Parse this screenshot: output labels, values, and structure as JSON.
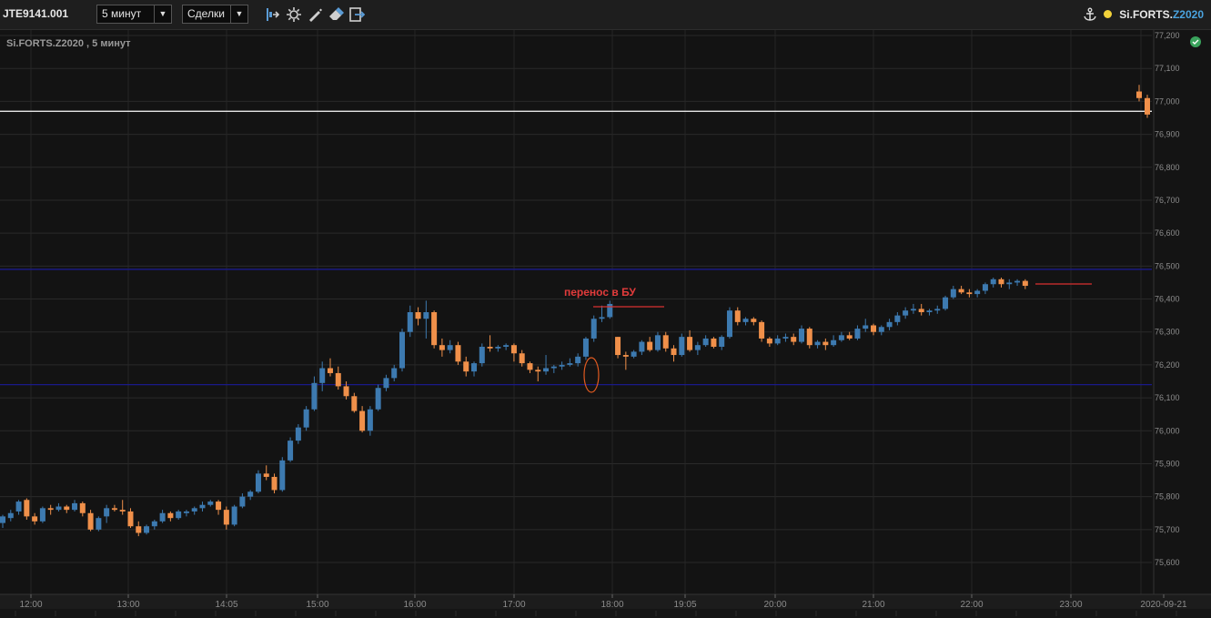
{
  "toolbar": {
    "account": "JTE9141.001",
    "timeframe": "5 минут",
    "mode": "Сделки",
    "symbol_prefix": "Si.FORTS.",
    "symbol_contract": "Z2020"
  },
  "chart_data": {
    "type": "candlestick",
    "title": "Si.FORTS.Z2020 , 5 минут",
    "y_ticks": [
      "77,200",
      "77,100",
      "77,000",
      "76,900",
      "76,800",
      "76,700",
      "76,600",
      "76,500",
      "76,400",
      "76,300",
      "76,200",
      "76,100",
      "76,000",
      "75,900",
      "75,800",
      "75,700",
      "75,600"
    ],
    "x_ticks": [
      "12:00",
      "13:00",
      "14:05",
      "15:00",
      "16:00",
      "17:00",
      "18:00",
      "19:05",
      "20:00",
      "21:00",
      "22:00",
      "23:00",
      "2020-09-21"
    ],
    "ylim": [
      75550,
      77220
    ],
    "annotation": "перенос в БУ",
    "horizontal_lines": [
      {
        "price": 76970,
        "color": "#ffffff"
      },
      {
        "price": 76490,
        "color": "#1a1a8a"
      },
      {
        "price": 76140,
        "color": "#1a1a8a"
      }
    ],
    "up_color": "#3d7ab0",
    "down_color": "#f0904a",
    "candles": [
      [
        75720,
        75745,
        75705,
        75740
      ],
      [
        75735,
        75760,
        75725,
        75750
      ],
      [
        75755,
        75790,
        75745,
        75785
      ],
      [
        75790,
        75795,
        75730,
        75740
      ],
      [
        75740,
        75750,
        75715,
        75725
      ],
      [
        75725,
        75770,
        75720,
        75765
      ],
      [
        75765,
        75775,
        75745,
        75760
      ],
      [
        75760,
        75780,
        75755,
        75770
      ],
      [
        75770,
        75775,
        75750,
        75760
      ],
      [
        75760,
        75790,
        75755,
        75780
      ],
      [
        75780,
        75785,
        75740,
        75750
      ],
      [
        75750,
        75760,
        75695,
        75700
      ],
      [
        75700,
        75740,
        75695,
        75735
      ],
      [
        75740,
        75775,
        75720,
        75765
      ],
      [
        75765,
        75775,
        75755,
        75760
      ],
      [
        75760,
        75790,
        75745,
        75755
      ],
      [
        75755,
        75765,
        75705,
        75710
      ],
      [
        75710,
        75725,
        75680,
        75690
      ],
      [
        75690,
        75715,
        75685,
        75710
      ],
      [
        75710,
        75730,
        75700,
        75725
      ],
      [
        75725,
        75760,
        75720,
        75750
      ],
      [
        75750,
        75755,
        75725,
        75735
      ],
      [
        75735,
        75760,
        75730,
        75755
      ],
      [
        75750,
        75760,
        75740,
        75755
      ],
      [
        75755,
        75770,
        75745,
        75765
      ],
      [
        75765,
        75785,
        75755,
        75775
      ],
      [
        75775,
        75790,
        75770,
        75785
      ],
      [
        75785,
        75790,
        75745,
        75760
      ],
      [
        75760,
        75770,
        75700,
        75715
      ],
      [
        75715,
        75775,
        75710,
        75770
      ],
      [
        75770,
        75810,
        75765,
        75800
      ],
      [
        75800,
        75820,
        75790,
        75815
      ],
      [
        75815,
        75880,
        75810,
        75870
      ],
      [
        75870,
        75895,
        75850,
        75860
      ],
      [
        75860,
        75870,
        75810,
        75820
      ],
      [
        75820,
        75920,
        75815,
        75910
      ],
      [
        75910,
        75980,
        75905,
        75970
      ],
      [
        75970,
        76020,
        75960,
        76010
      ],
      [
        76010,
        76075,
        76000,
        76065
      ],
      [
        76065,
        76165,
        76060,
        76145
      ],
      [
        76145,
        76210,
        76120,
        76190
      ],
      [
        76190,
        76220,
        76165,
        76175
      ],
      [
        76175,
        76195,
        76125,
        76135
      ],
      [
        76135,
        76150,
        76095,
        76105
      ],
      [
        76105,
        76115,
        76055,
        76060
      ],
      [
        76060,
        76075,
        75995,
        76000
      ],
      [
        76000,
        76075,
        75985,
        76065
      ],
      [
        76065,
        76140,
        76060,
        76130
      ],
      [
        76130,
        76170,
        76120,
        76160
      ],
      [
        76160,
        76200,
        76150,
        76190
      ],
      [
        76190,
        76310,
        76180,
        76300
      ],
      [
        76300,
        76380,
        76285,
        76360
      ],
      [
        76360,
        76375,
        76320,
        76340
      ],
      [
        76340,
        76395,
        76280,
        76360
      ],
      [
        76360,
        76365,
        76250,
        76260
      ],
      [
        76260,
        76280,
        76225,
        76245
      ],
      [
        76245,
        76275,
        76235,
        76260
      ],
      [
        76260,
        76270,
        76200,
        76210
      ],
      [
        76210,
        76225,
        76165,
        76180
      ],
      [
        76180,
        76210,
        76165,
        76205
      ],
      [
        76205,
        76265,
        76195,
        76255
      ],
      [
        76255,
        76290,
        76240,
        76250
      ],
      [
        76250,
        76260,
        76240,
        76255
      ],
      [
        76255,
        76265,
        76245,
        76260
      ],
      [
        76260,
        76265,
        76210,
        76235
      ],
      [
        76235,
        76245,
        76195,
        76205
      ],
      [
        76205,
        76210,
        76175,
        76185
      ],
      [
        76185,
        76195,
        76150,
        76180
      ],
      [
        76180,
        76230,
        76170,
        76190
      ],
      [
        76190,
        76200,
        76175,
        76195
      ],
      [
        76195,
        76210,
        76185,
        76200
      ],
      [
        76200,
        76220,
        76195,
        76205
      ],
      [
        76205,
        76235,
        76195,
        76225
      ],
      [
        76225,
        76285,
        76215,
        76280
      ],
      [
        76280,
        76350,
        76270,
        76340
      ],
      [
        76340,
        76380,
        76330,
        76345
      ],
      [
        76345,
        76395,
        76340,
        76385
      ],
      [
        76285,
        76285,
        76220,
        76230
      ],
      [
        76230,
        76240,
        76185,
        76225
      ],
      [
        76225,
        76245,
        76220,
        76240
      ],
      [
        76240,
        76275,
        76230,
        76270
      ],
      [
        76270,
        76285,
        76240,
        76245
      ],
      [
        76245,
        76300,
        76240,
        76290
      ],
      [
        76290,
        76300,
        76240,
        76250
      ],
      [
        76250,
        76260,
        76210,
        76230
      ],
      [
        76230,
        76295,
        76225,
        76285
      ],
      [
        76285,
        76305,
        76240,
        76245
      ],
      [
        76245,
        76270,
        76230,
        76260
      ],
      [
        76260,
        76290,
        76255,
        76280
      ],
      [
        76280,
        76285,
        76250,
        76255
      ],
      [
        76255,
        76290,
        76245,
        76285
      ],
      [
        76285,
        76375,
        76280,
        76365
      ],
      [
        76365,
        76375,
        76320,
        76330
      ],
      [
        76330,
        76345,
        76320,
        76340
      ],
      [
        76340,
        76345,
        76320,
        76330
      ],
      [
        76330,
        76335,
        76270,
        76280
      ],
      [
        76280,
        76285,
        76255,
        76265
      ],
      [
        76265,
        76290,
        76260,
        76280
      ],
      [
        76280,
        76295,
        76270,
        76285
      ],
      [
        76285,
        76295,
        76260,
        76270
      ],
      [
        76270,
        76320,
        76265,
        76310
      ],
      [
        76310,
        76315,
        76250,
        76260
      ],
      [
        76260,
        76275,
        76250,
        76270
      ],
      [
        76270,
        76280,
        76245,
        76260
      ],
      [
        76260,
        76290,
        76255,
        76275
      ],
      [
        76275,
        76300,
        76270,
        76290
      ],
      [
        76290,
        76300,
        76275,
        76280
      ],
      [
        76280,
        76320,
        76275,
        76310
      ],
      [
        76310,
        76340,
        76300,
        76320
      ],
      [
        76320,
        76325,
        76290,
        76300
      ],
      [
        76300,
        76320,
        76290,
        76315
      ],
      [
        76315,
        76340,
        76305,
        76330
      ],
      [
        76330,
        76360,
        76320,
        76350
      ],
      [
        76350,
        76375,
        76340,
        76365
      ],
      [
        76365,
        76385,
        76355,
        76370
      ],
      [
        76370,
        76385,
        76350,
        76360
      ],
      [
        76360,
        76370,
        76350,
        76365
      ],
      [
        76365,
        76380,
        76355,
        76370
      ],
      [
        76370,
        76410,
        76365,
        76405
      ],
      [
        76405,
        76440,
        76400,
        76430
      ],
      [
        76430,
        76440,
        76415,
        76420
      ],
      [
        76420,
        76430,
        76405,
        76415
      ],
      [
        76415,
        76430,
        76405,
        76425
      ],
      [
        76425,
        76450,
        76415,
        76445
      ],
      [
        76445,
        76465,
        76435,
        76460
      ],
      [
        76460,
        76465,
        76435,
        76445
      ],
      [
        76445,
        76460,
        76430,
        76450
      ],
      [
        76450,
        76460,
        76440,
        76455
      ],
      [
        76455,
        76460,
        76430,
        76440
      ],
      [
        77030,
        77050,
        77000,
        77010
      ],
      [
        77010,
        77020,
        76950,
        76960
      ]
    ]
  }
}
